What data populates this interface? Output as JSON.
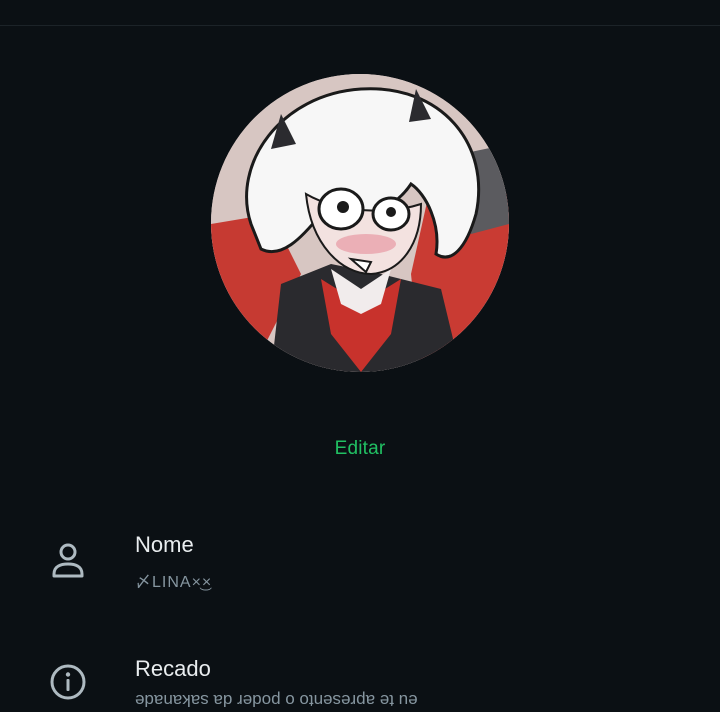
{
  "profile": {
    "edit_label": "Editar"
  },
  "fields": {
    "name": {
      "label": "Nome",
      "value": "〆LINA×͜×",
      "icon": "person-icon"
    },
    "about": {
      "label": "Recado",
      "value": "eu te apresento o poder da sakanade",
      "icon": "info-icon"
    }
  },
  "colors": {
    "background": "#0b1014",
    "accent": "#21c063",
    "primary_text": "#e9edef",
    "secondary_text": "#8696a0"
  }
}
